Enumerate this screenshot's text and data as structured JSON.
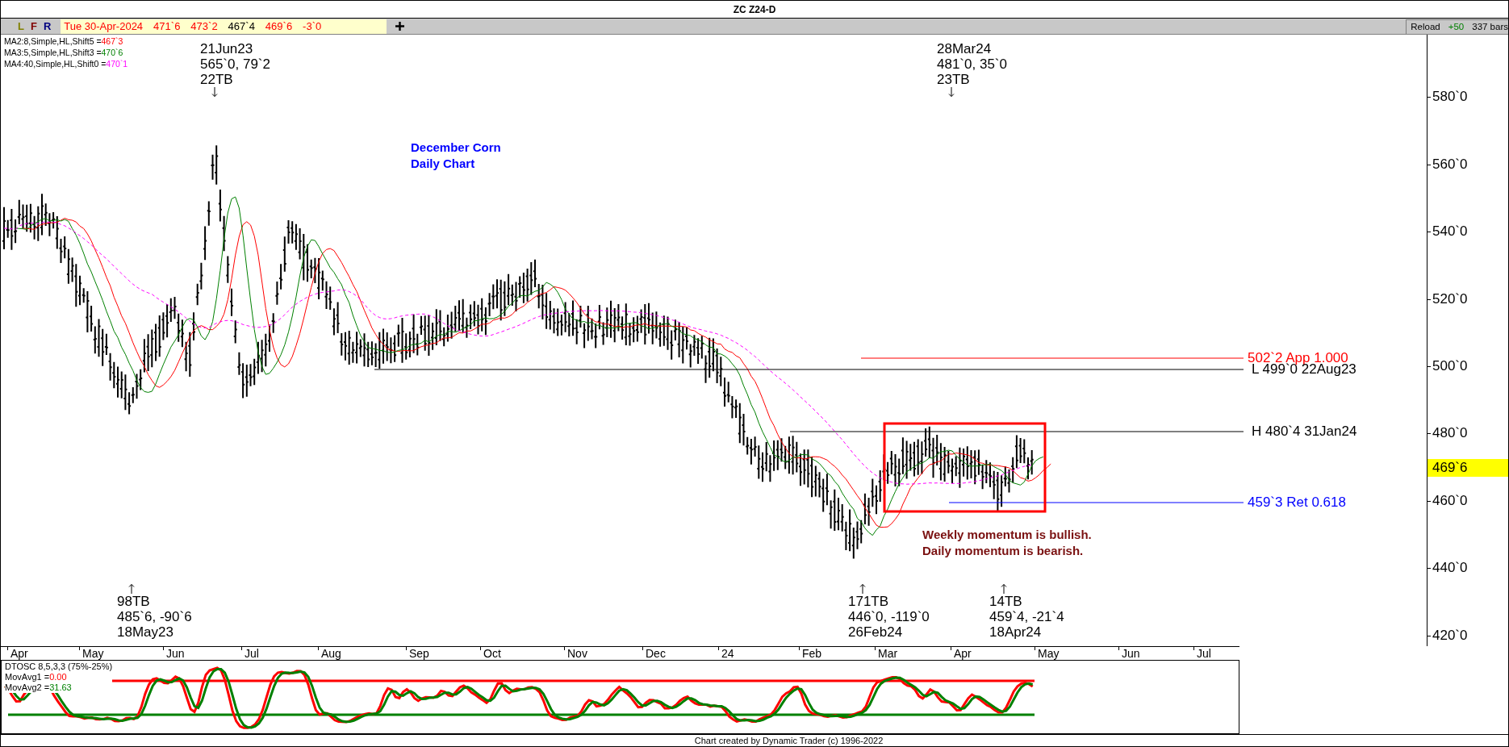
{
  "title": "ZC Z24-D",
  "toolbar": {
    "buttons": [
      {
        "text": "L",
        "color": "#808000"
      },
      {
        "text": "F",
        "color": "#800000"
      },
      {
        "text": "R",
        "color": "#000080"
      }
    ],
    "quote": [
      {
        "text": "Tue 30-Apr-2024",
        "color": "#ff0000"
      },
      {
        "text": "471`6",
        "color": "#ff0000"
      },
      {
        "text": "473`2",
        "color": "#ff0000"
      },
      {
        "text": "467`4",
        "color": "#000000"
      },
      {
        "text": "469`6",
        "color": "#ff0000"
      },
      {
        "text": "-3`0",
        "color": "#ff0000"
      }
    ],
    "reload": "Reload",
    "reload_step": "+50",
    "bar_count": "337 bars"
  },
  "indicators": [
    {
      "label": "MA2:8,Simple,HL,Shift5 =",
      "value": "467`3",
      "color": "#ff0000"
    },
    {
      "label": "MA3:5,Simple,HL,Shift3 =",
      "value": "470`6",
      "color": "#008000"
    },
    {
      "label": "MA4:40,Simple,HL,Shift0 =",
      "value": "470`1",
      "color": "#ff00ff"
    }
  ],
  "chart_title": [
    "December Corn",
    "Daily Chart"
  ],
  "pivots": [
    {
      "kind": "high",
      "date": "21Jun23",
      "values": "565`0, 79`2",
      "label": "22TB"
    },
    {
      "kind": "high",
      "date": "28Mar24",
      "values": "481`0, 35`0",
      "label": "23TB"
    },
    {
      "kind": "low",
      "label": "98TB",
      "values": "485`6, -90`6",
      "date": "18May23"
    },
    {
      "kind": "low",
      "label": "171TB",
      "values": "446`0, -119`0",
      "date": "26Feb24"
    },
    {
      "kind": "low",
      "label": "14TB",
      "values": "459`4, -21`4",
      "date": "18Apr24"
    }
  ],
  "levels": [
    {
      "text": "502`2 App 1.000",
      "color": "#ff0000"
    },
    {
      "text": "L 499`0 22Aug23",
      "color": "#000000"
    },
    {
      "text": "H 480`4 31Jan24",
      "color": "#000000"
    },
    {
      "text": "459`3 Ret 0.618",
      "color": "#0000ff"
    }
  ],
  "commentary": [
    "Weekly momentum is bullish.",
    "Daily momentum is bearish."
  ],
  "price_axis": [
    "580`0",
    "560`0",
    "540`0",
    "520`0",
    "500`0",
    "480`0",
    "460`0",
    "440`0",
    "420`0"
  ],
  "current_price": "469`6",
  "months": [
    "Apr",
    "May",
    "Jun",
    "Jul",
    "Aug",
    "Sep",
    "Oct",
    "Nov",
    "Dec",
    "24",
    "Feb",
    "Mar",
    "Apr",
    "May",
    "Jun",
    "Jul"
  ],
  "oscillator": {
    "name": "DTOSC 8,5,3,3 (75%-25%)",
    "averages": [
      {
        "label": "MovAvg1 =",
        "value": "0.00",
        "color": "#ff0000"
      },
      {
        "label": "MovAvg2 =",
        "value": "31.63",
        "color": "#008000"
      }
    ]
  },
  "footer": "Chart created by Dynamic Trader  (c) 1996-2022"
}
